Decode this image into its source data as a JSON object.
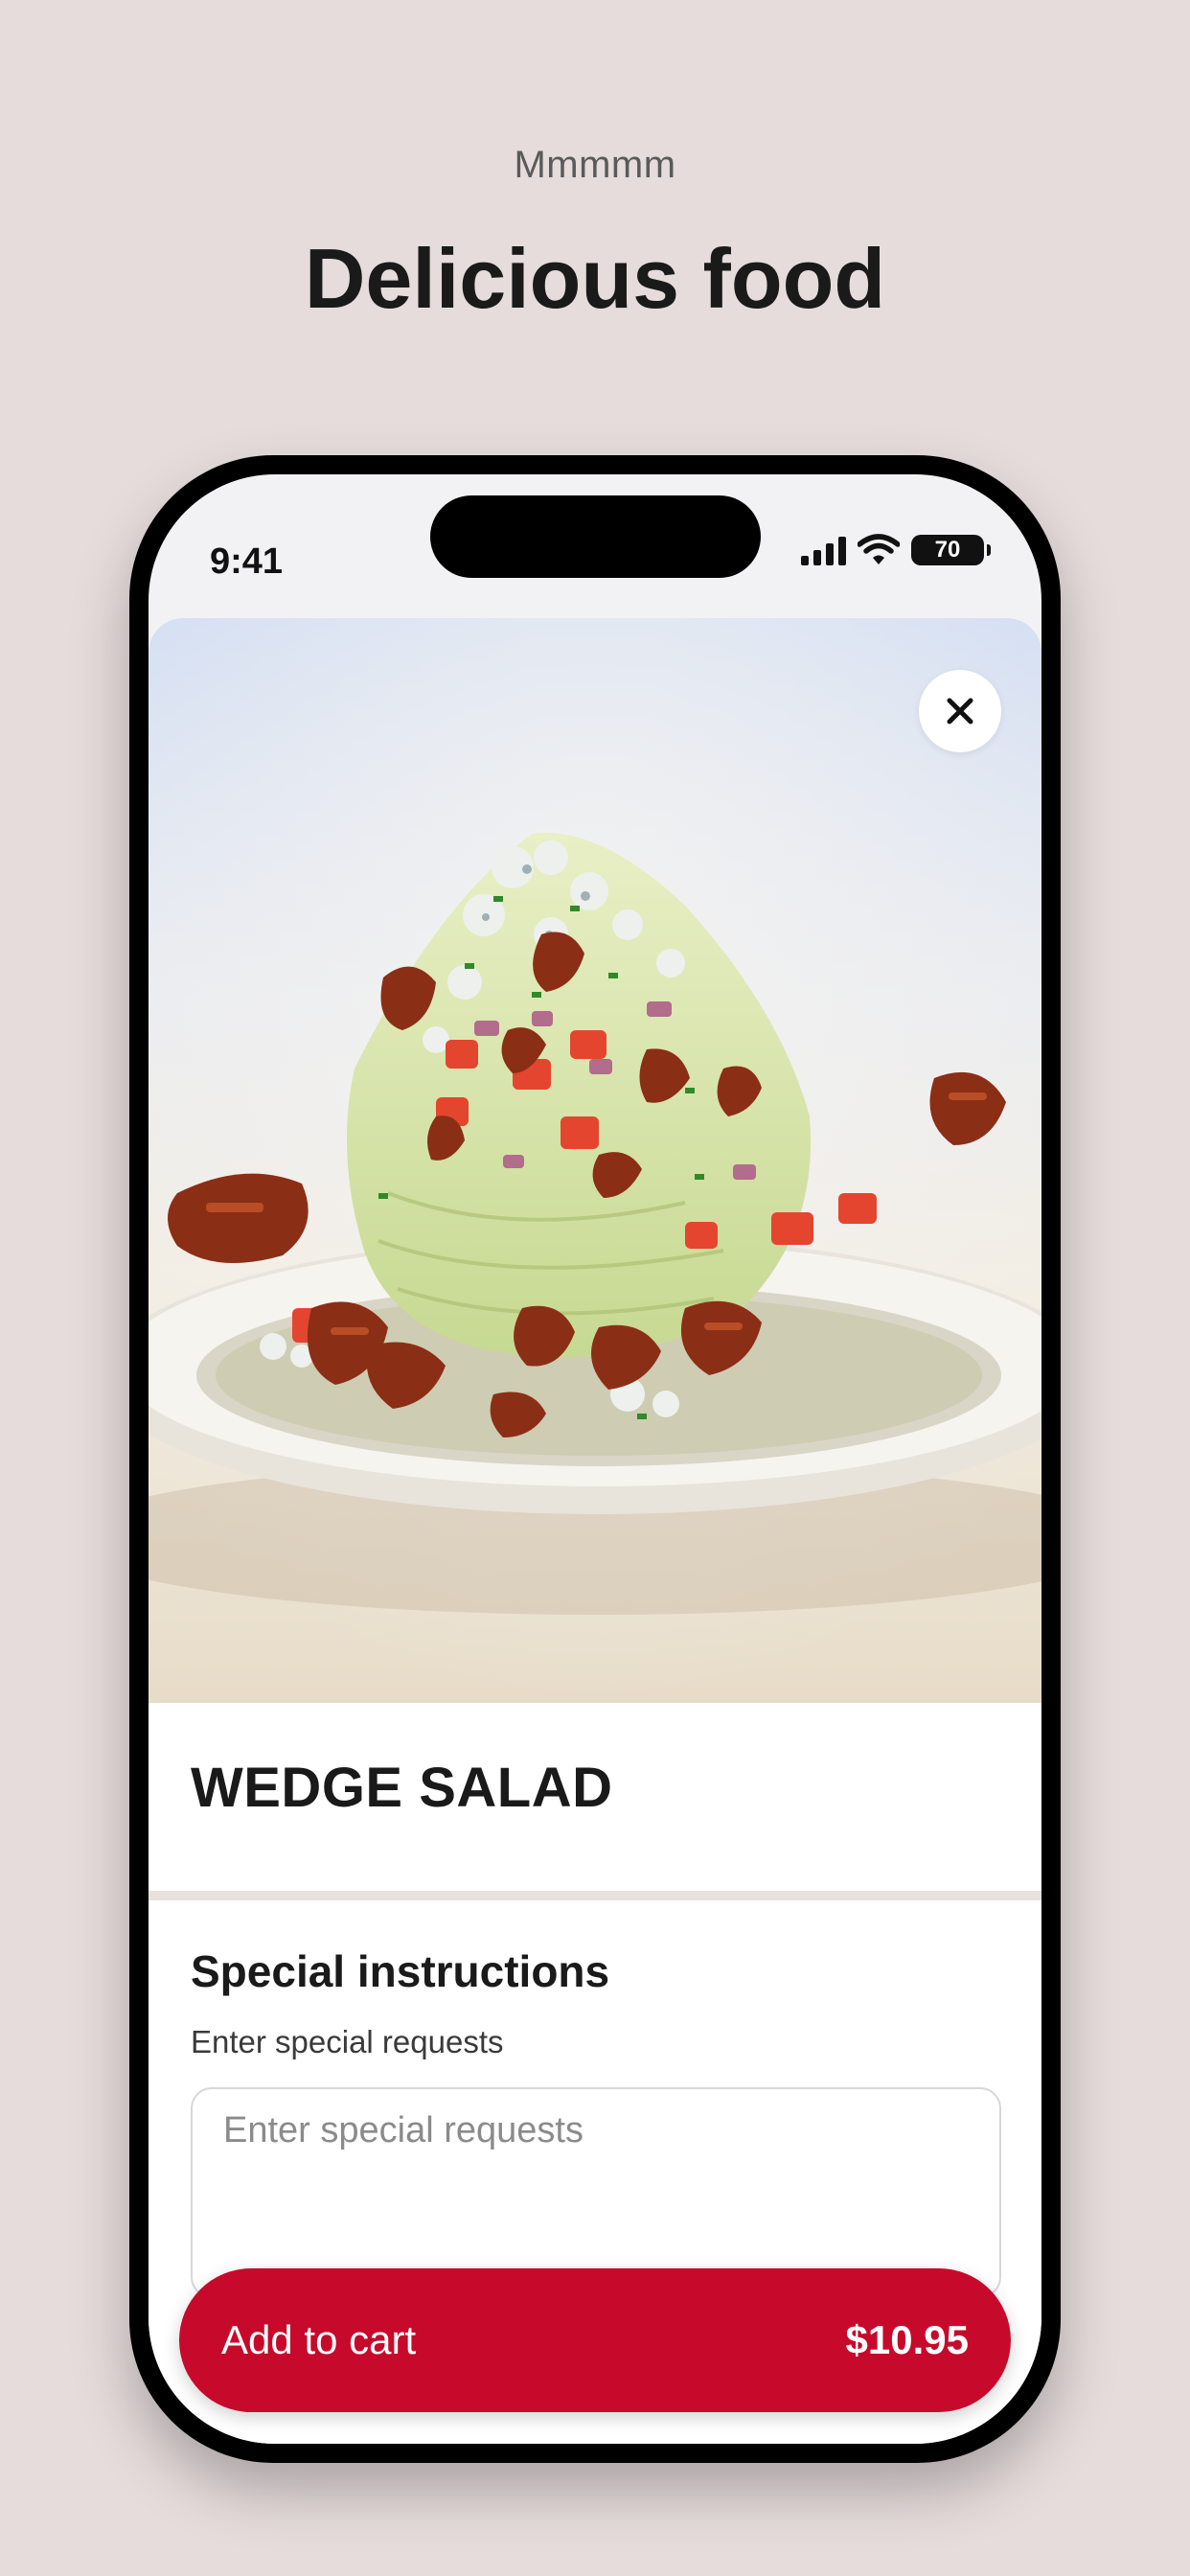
{
  "page": {
    "eyebrow": "Mmmmm",
    "headline": "Delicious food"
  },
  "status_bar": {
    "time": "9:41",
    "battery": "70",
    "icons": [
      "cellular-signal-icon",
      "wifi-icon",
      "battery-icon"
    ]
  },
  "item": {
    "image_icon": "food-photo-wedge-salad",
    "close_icon": "close-icon",
    "title": "WEDGE SALAD"
  },
  "instructions": {
    "heading": "Special instructions",
    "subheading": "Enter special requests",
    "placeholder": "Enter special requests",
    "value": ""
  },
  "cart_button": {
    "label": "Add to cart",
    "price": "$10.95"
  },
  "colors": {
    "background": "#e6dcdc",
    "accent": "#c70a2b",
    "text": "#1a1a1a"
  }
}
